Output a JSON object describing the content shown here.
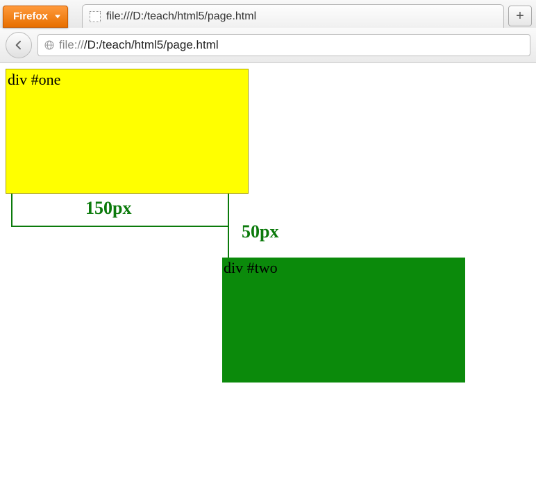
{
  "chrome": {
    "firefox_button_label": "Firefox",
    "tab_title": "file:///D:/teach/html5/page.html",
    "new_tab_label": "+",
    "url_scheme": "file://",
    "url_path": "/D:/teach/html5/page.html"
  },
  "page": {
    "div_one_label": "div #one",
    "div_two_label": "div #two",
    "measure_150": "150px",
    "measure_50": "50px"
  }
}
